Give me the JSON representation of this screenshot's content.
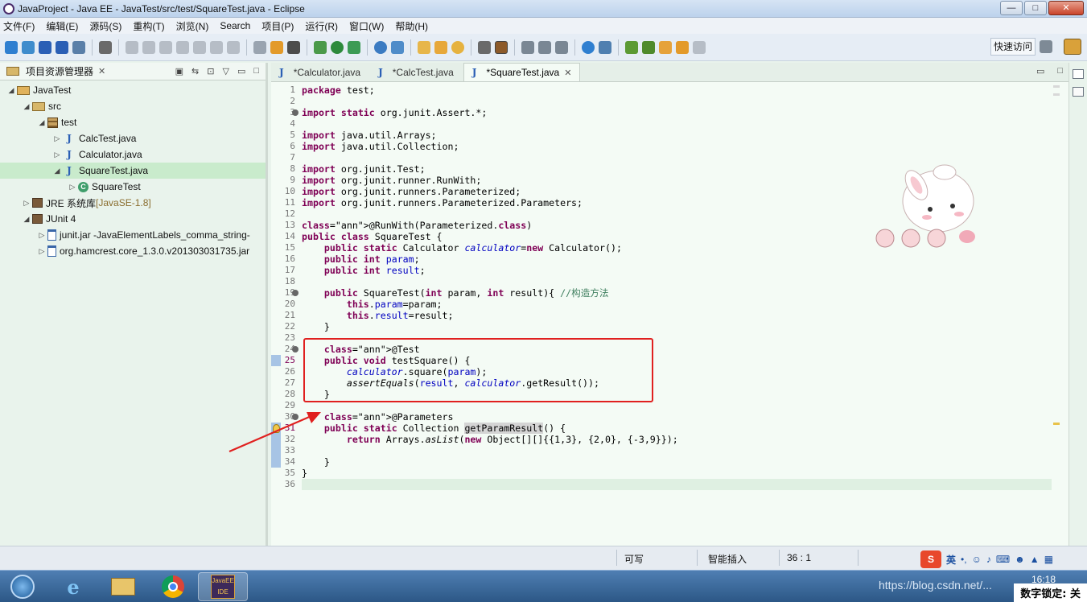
{
  "window": {
    "title": "JavaProject  - Java EE  - JavaTest/src/test/SquareTest.java  - Eclipse",
    "buttons": {
      "minimize": "—",
      "maximize": "□",
      "close": "✕"
    }
  },
  "menu": [
    "文件(F)",
    "编辑(E)",
    "源码(S)",
    "重构(T)",
    "浏览(N)",
    "Search",
    "项目(P)",
    "运行(R)",
    "窗口(W)",
    "帮助(H)"
  ],
  "toolbar": {
    "quick_access": "快速访问"
  },
  "project_explorer": {
    "title": "项目资源管理器",
    "close": "✕",
    "tree": [
      {
        "label": "JavaTest",
        "indent": 1,
        "arrow": "◢",
        "icon": "project-folder-icon"
      },
      {
        "label": "src",
        "indent": 2,
        "arrow": "◢",
        "icon": "source-folder-icon"
      },
      {
        "label": "test",
        "indent": 3,
        "arrow": "◢",
        "icon": "package-icon"
      },
      {
        "label": "CalcTest.java",
        "indent": 4,
        "arrow": "▷",
        "icon": "java-file-icon"
      },
      {
        "label": "Calculator.java",
        "indent": 4,
        "arrow": "▷",
        "icon": "java-file-icon"
      },
      {
        "label": "SquareTest.java",
        "indent": 4,
        "arrow": "◢",
        "icon": "java-file-icon",
        "selected": true
      },
      {
        "label": "SquareTest",
        "indent": 5,
        "arrow": "▷",
        "icon": "class-icon"
      },
      {
        "label": "JRE 系统库",
        "suffix": "[JavaSE-1.8]",
        "indent": 2,
        "arrow": "▷",
        "icon": "library-icon"
      },
      {
        "label": "JUnit 4",
        "indent": 2,
        "arrow": "◢",
        "icon": "library-icon"
      },
      {
        "label": "junit.jar -JavaElementLabels_comma_string-",
        "indent": 3,
        "arrow": "▷",
        "icon": "jar-icon"
      },
      {
        "label": "org.hamcrest.core_1.3.0.v201303031735.jar",
        "indent": 3,
        "arrow": "▷",
        "icon": "jar-icon"
      }
    ]
  },
  "editor": {
    "tabs": [
      {
        "label": "*Calculator.java",
        "active": false
      },
      {
        "label": "*CalcTest.java",
        "active": false
      },
      {
        "label": "*SquareTest.java",
        "active": true
      }
    ],
    "tab_close": "✕",
    "lines": [
      "package test;",
      "",
      "import static org.junit.Assert.*;",
      "",
      "import java.util.Arrays;",
      "import java.util.Collection;",
      "",
      "import org.junit.Test;",
      "import org.junit.runner.RunWith;",
      "import org.junit.runners.Parameterized;",
      "import org.junit.runners.Parameterized.Parameters;",
      "",
      "@RunWith(Parameterized.class)",
      "public class SquareTest {",
      "    public static Calculator calculator=new Calculator();",
      "    public int param;",
      "    public int result;",
      "",
      "    public SquareTest(int param, int result){ //构造方法",
      "        this.param=param;",
      "        this.result=result;",
      "    }",
      "",
      "    @Test",
      "    public void testSquare() {",
      "        calculator.square(param);",
      "        assertEquals(result, calculator.getResult());",
      "    }",
      "",
      "    @Parameters",
      "    public static Collection getParamResult() {",
      "        return Arrays.asList(new Object[][]{{1,3}, {2,0}, {-3,9}});",
      "",
      "    }",
      "}",
      ""
    ]
  },
  "statusbar": {
    "writable": "可写",
    "insert_mode": "智能插入",
    "position": "36 : 1"
  },
  "ime": {
    "mode": "英"
  },
  "taskbar": {
    "clock": "16:18",
    "numlock": "数字锁定: 关"
  },
  "watermark": "https://blog.csdn.net/..."
}
